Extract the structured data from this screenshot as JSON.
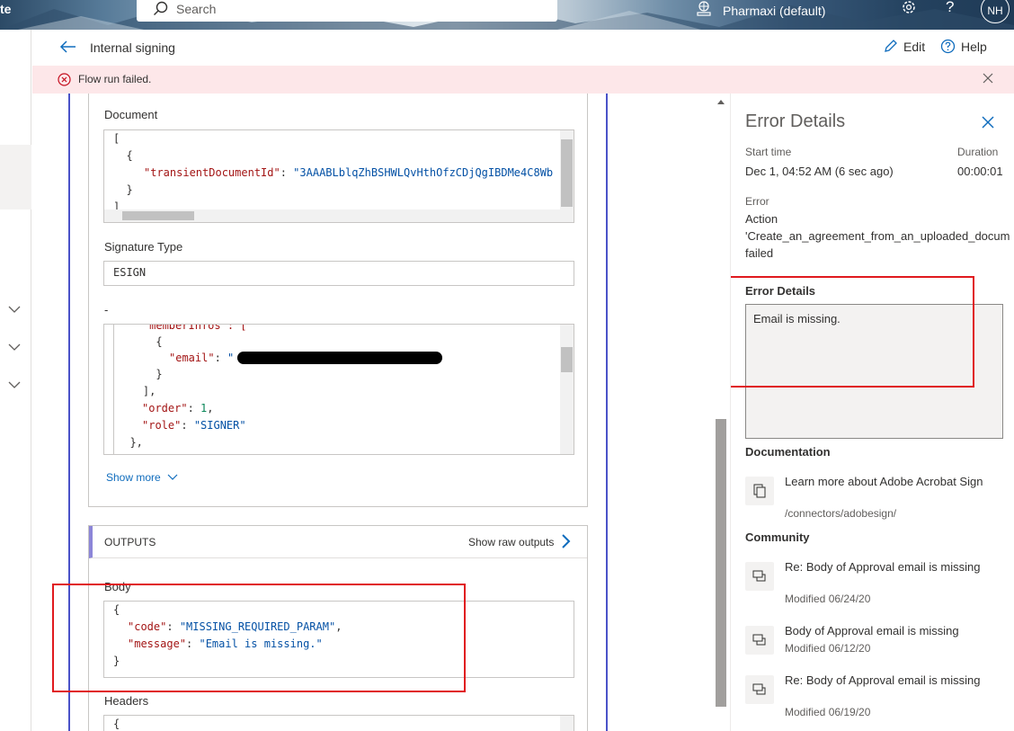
{
  "header": {
    "app_fragment": "te",
    "search_placeholder": "Search",
    "environment": "Pharmaxi (default)",
    "avatar_initials": "NH"
  },
  "command_bar": {
    "title": "Internal signing",
    "edit_label": "Edit",
    "help_label": "Help"
  },
  "banner": {
    "message": "Flow run failed."
  },
  "inputs": {
    "document_label": "Document",
    "document_code": {
      "l1": "[",
      "l2": "  {",
      "l3_key": "\"transientDocumentId\"",
      "l3_sep": ": ",
      "l3_val": "\"3AAABLblqZhBSHWLQvHthOfzCDjQgIBDMe4C8Wb",
      "l4": "  }",
      "l5": "]"
    },
    "signature_type_label": "Signature Type",
    "signature_type_value": "ESIGN",
    "participants_label": "-",
    "participants_code": {
      "l1": "    \"memberInfos\": [",
      "l2": "      {",
      "l3_key": "\"email\"",
      "l3_sep": ": ",
      "l3_val": "\"",
      "l4": "      }",
      "l5": "    ],",
      "l6_key": "\"order\"",
      "l6_sep": ": ",
      "l6_val": "1",
      "l6_end": ",",
      "l7_key": "\"role\"",
      "l7_sep": ": ",
      "l7_val": "\"SIGNER\"",
      "l8": "  },"
    },
    "show_more": "Show more"
  },
  "outputs": {
    "title": "OUTPUTS",
    "raw_outputs": "Show raw outputs",
    "body_label": "Body",
    "body_code": {
      "l1": "{",
      "l2_key": "\"code\"",
      "l2_sep": ": ",
      "l2_val": "\"MISSING_REQUIRED_PARAM\"",
      "l2_end": ",",
      "l3_key": "\"message\"",
      "l3_sep": ": ",
      "l3_val": "\"Email is missing.\"",
      "l4": "}"
    },
    "headers_label": "Headers",
    "headers_code": {
      "l1": "{"
    }
  },
  "error_panel": {
    "title": "Error Details",
    "start_time_label": "Start time",
    "start_time_value": "Dec 1, 04:52 AM (6 sec ago)",
    "duration_label": "Duration",
    "duration_value": "00:00:01",
    "error_label": "Error",
    "error_line1": "Action",
    "error_line2": "'Create_an_agreement_from_an_uploaded_docum",
    "error_line3": "failed",
    "details_label": "Error Details",
    "details_value": "Email is missing.",
    "documentation_label": "Documentation",
    "doc_link_title": "Learn more about Adobe Acrobat Sign",
    "doc_link_path": "/connectors/adobesign/",
    "community_label": "Community",
    "community": [
      {
        "title": "Re: Body of Approval email is missing",
        "modified": "Modified 06/24/20"
      },
      {
        "title": "Body of Approval email is missing",
        "modified": "Modified 06/12/20"
      },
      {
        "title": "Re: Body of Approval email is missing",
        "modified": "Modified 06/19/20"
      }
    ]
  },
  "colors": {
    "accent": "#0f6cbd",
    "error_banner": "#fde7e9",
    "error_icon": "#c50f1f",
    "annotation": "#e0191e",
    "json_key": "#a31515",
    "json_string": "#0451a5",
    "json_number": "#098658"
  }
}
